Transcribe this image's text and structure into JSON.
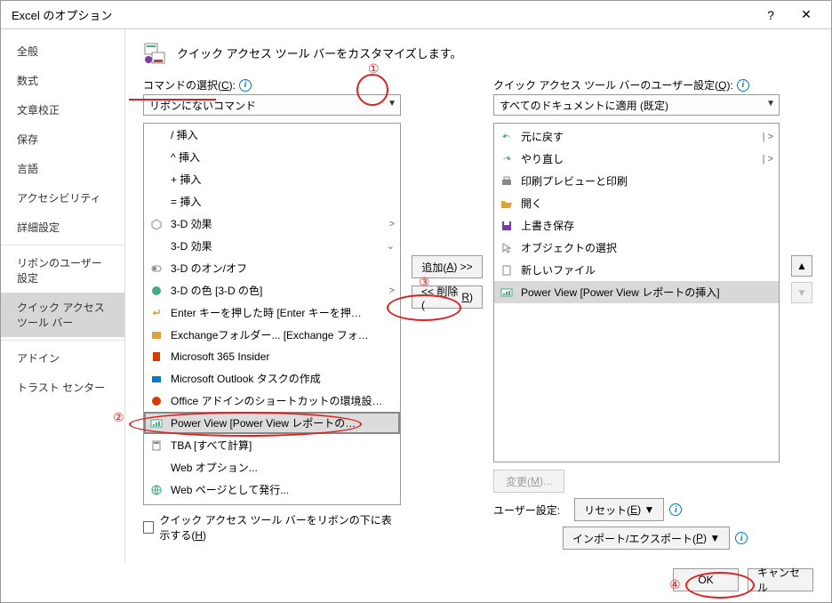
{
  "window": {
    "title": "Excel のオプション"
  },
  "sidebar": {
    "items": [
      "全般",
      "数式",
      "文章校正",
      "保存",
      "言語",
      "アクセシビリティ",
      "詳細設定",
      "リボンのユーザー設定",
      "クイック アクセス ツール バー",
      "アドイン",
      "トラスト センター"
    ],
    "selected_index": 8
  },
  "header": {
    "text": "クイック アクセス ツール バーをカスタマイズします。"
  },
  "left": {
    "label": "コマンドの選択(C):",
    "combo": "リボンにないコマンド",
    "items": [
      {
        "icon": "insert",
        "text": "/ 挿入"
      },
      {
        "icon": "insert",
        "text": "^ 挿入"
      },
      {
        "icon": "plus",
        "text": "+ 挿入"
      },
      {
        "icon": "equals",
        "text": "= 挿入"
      },
      {
        "icon": "cube",
        "text": "3-D 効果",
        "sub": ">"
      },
      {
        "icon": "blank",
        "text": "3-D 効果",
        "sub": "⌄"
      },
      {
        "icon": "toggle",
        "text": "3-D のオン/オフ"
      },
      {
        "icon": "palette",
        "text": "3-D の色 [3-D の色]",
        "sub": ">"
      },
      {
        "icon": "enter",
        "text": "Enter キーを押した時 [Enter キーを押…"
      },
      {
        "icon": "exchange",
        "text": "Exchangeフォルダー... [Exchange フォ…"
      },
      {
        "icon": "office",
        "text": "Microsoft 365 Insider"
      },
      {
        "icon": "outlook",
        "text": "Microsoft Outlook タスクの作成"
      },
      {
        "icon": "addin",
        "text": "Office アドインのショートカットの環境設…"
      },
      {
        "icon": "powerview",
        "text": "Power View [Power View レポートの…",
        "selected": true
      },
      {
        "icon": "calc",
        "text": "TBA [すべて計算]"
      },
      {
        "icon": "blank",
        "text": "Web オプション..."
      },
      {
        "icon": "web",
        "text": "Web ページとして発行..."
      }
    ],
    "checkbox": "クイック アクセス ツール バーをリボンの下に表示する(H)"
  },
  "mid": {
    "add": "追加(A) >>",
    "remove": "<< 削除(R)"
  },
  "right": {
    "label": "クイック アクセス ツール バーのユーザー設定(Q):",
    "combo": "すべてのドキュメントに適用 (既定)",
    "items": [
      {
        "icon": "undo",
        "text": "元に戻す",
        "sub": "| >"
      },
      {
        "icon": "redo",
        "text": "やり直し",
        "sub": "| >"
      },
      {
        "icon": "print",
        "text": "印刷プレビューと印刷"
      },
      {
        "icon": "open",
        "text": "開く"
      },
      {
        "icon": "save",
        "text": "上書き保存"
      },
      {
        "icon": "select",
        "text": "オブジェクトの選択"
      },
      {
        "icon": "newfile",
        "text": "新しいファイル"
      },
      {
        "icon": "powerview",
        "text": "Power View [Power View レポートの挿入]",
        "hl": true
      }
    ],
    "modify": "変更(M)...",
    "user_label": "ユーザー設定:",
    "reset": "リセット(E) ▼",
    "import": "インポート/エクスポート(P) ▼"
  },
  "footer": {
    "ok": "OK",
    "cancel": "キャンセル"
  },
  "annotations": {
    "n1": "①",
    "n2": "②",
    "n3": "③",
    "n4": "④"
  }
}
